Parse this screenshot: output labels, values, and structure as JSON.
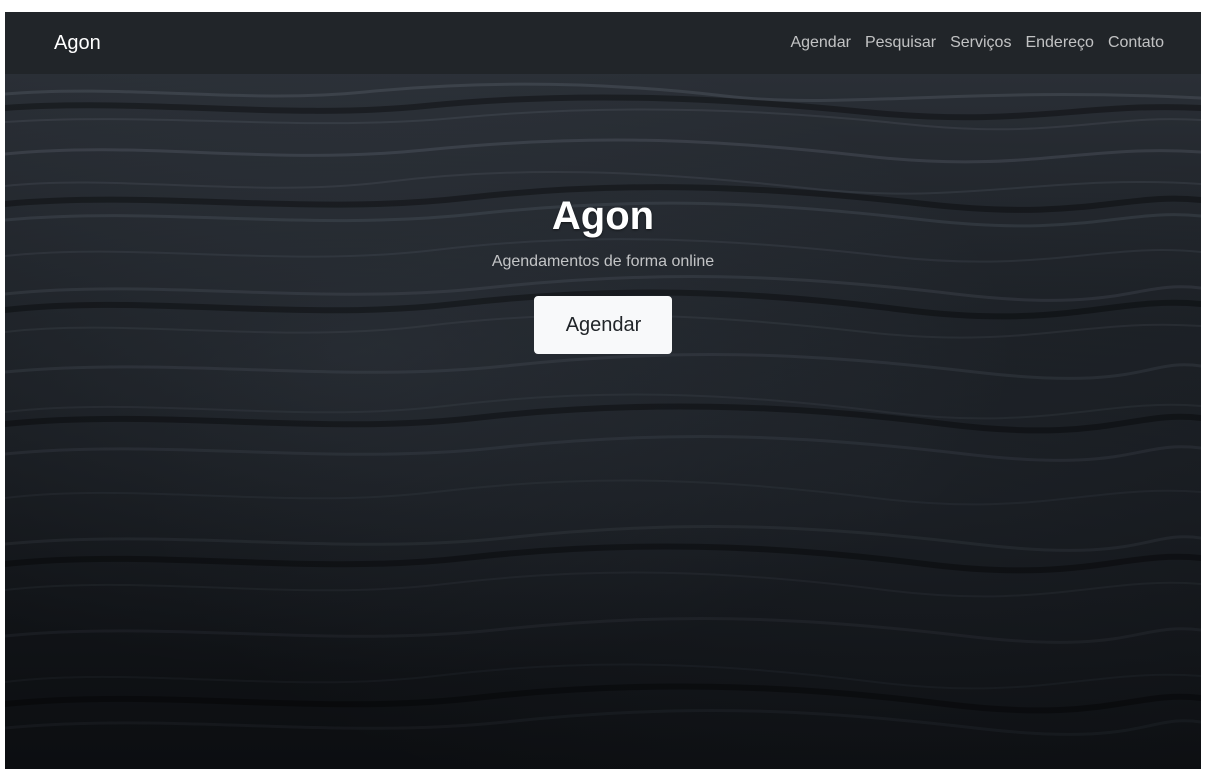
{
  "navbar": {
    "brand": "Agon",
    "links": [
      {
        "label": "Agendar"
      },
      {
        "label": "Pesquisar"
      },
      {
        "label": "Serviços"
      },
      {
        "label": "Endereço"
      },
      {
        "label": "Contato"
      }
    ]
  },
  "hero": {
    "title": "Agon",
    "subtitle": "Agendamentos de forma online",
    "button_label": "Agendar",
    "background": "dark-ocean-water-image"
  },
  "colors": {
    "navbar_bg": "#212529",
    "button_bg": "#f8f9fa",
    "button_text": "#212529"
  }
}
